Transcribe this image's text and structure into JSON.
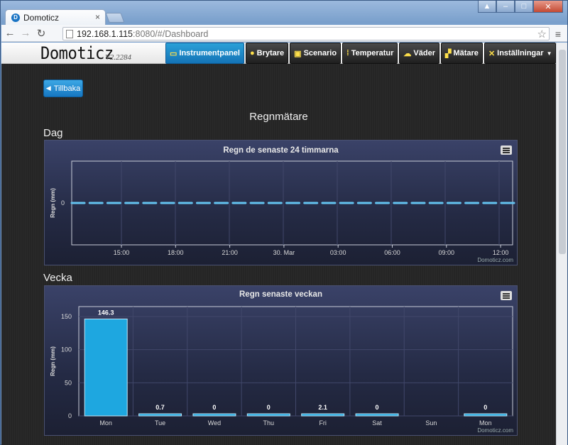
{
  "browser": {
    "tab_title": "Domoticz",
    "url_host": "192.168.1.115",
    "url_path": ":8080/#/Dashboard"
  },
  "app": {
    "logo": "Domoticz",
    "version": "V2.2284",
    "nav": [
      {
        "label": "Instrumentpanel",
        "icon": "monitor-icon",
        "active": true
      },
      {
        "label": "Brytare",
        "icon": "bulb-icon"
      },
      {
        "label": "Scenario",
        "icon": "screen-icon"
      },
      {
        "label": "Temperatur",
        "icon": "thermometer-icon"
      },
      {
        "label": "Väder",
        "icon": "cloud-icon"
      },
      {
        "label": "Mätare",
        "icon": "meter-icon"
      },
      {
        "label": "Inställningar",
        "icon": "tools-icon",
        "dropdown": true
      }
    ],
    "back_label": "Tillbaka",
    "page_title": "Regnmätare",
    "section_day": "Dag",
    "section_week": "Vecka",
    "credit": "Domoticz.com",
    "accent": "#1e90d6"
  },
  "chart_data": [
    {
      "type": "line",
      "title": "Regn de senaste 24 timmarna",
      "ylabel": "Regn (mm)",
      "xlabel": "",
      "x_ticks": [
        "15:00",
        "18:00",
        "21:00",
        "30. Mar",
        "03:00",
        "06:00",
        "09:00",
        "12:00"
      ],
      "y_ticks": [
        0
      ],
      "series": [
        {
          "values": [
            0,
            0,
            0,
            0,
            0,
            0,
            0,
            0,
            0,
            0,
            0,
            0,
            0,
            0,
            0,
            0,
            0,
            0,
            0,
            0,
            0,
            0,
            0,
            0,
            0
          ]
        }
      ],
      "color": "#64c3f0",
      "grid": true
    },
    {
      "type": "bar",
      "title": "Regn senaste veckan",
      "ylabel": "Regn (mm)",
      "xlabel": "",
      "categories": [
        "Mon",
        "Tue",
        "Wed",
        "Thu",
        "Fri",
        "Sat",
        "Sun",
        "Mon"
      ],
      "values": [
        146.3,
        0.7,
        0,
        0,
        2.1,
        0,
        null,
        0
      ],
      "data_labels": [
        "146.3",
        "0.7",
        "0",
        "0",
        "2.1",
        "0",
        "",
        "0"
      ],
      "y_ticks": [
        0,
        50,
        100,
        150
      ],
      "ylim": [
        0,
        165
      ],
      "color": "#1ea7e0",
      "grid": true
    }
  ]
}
